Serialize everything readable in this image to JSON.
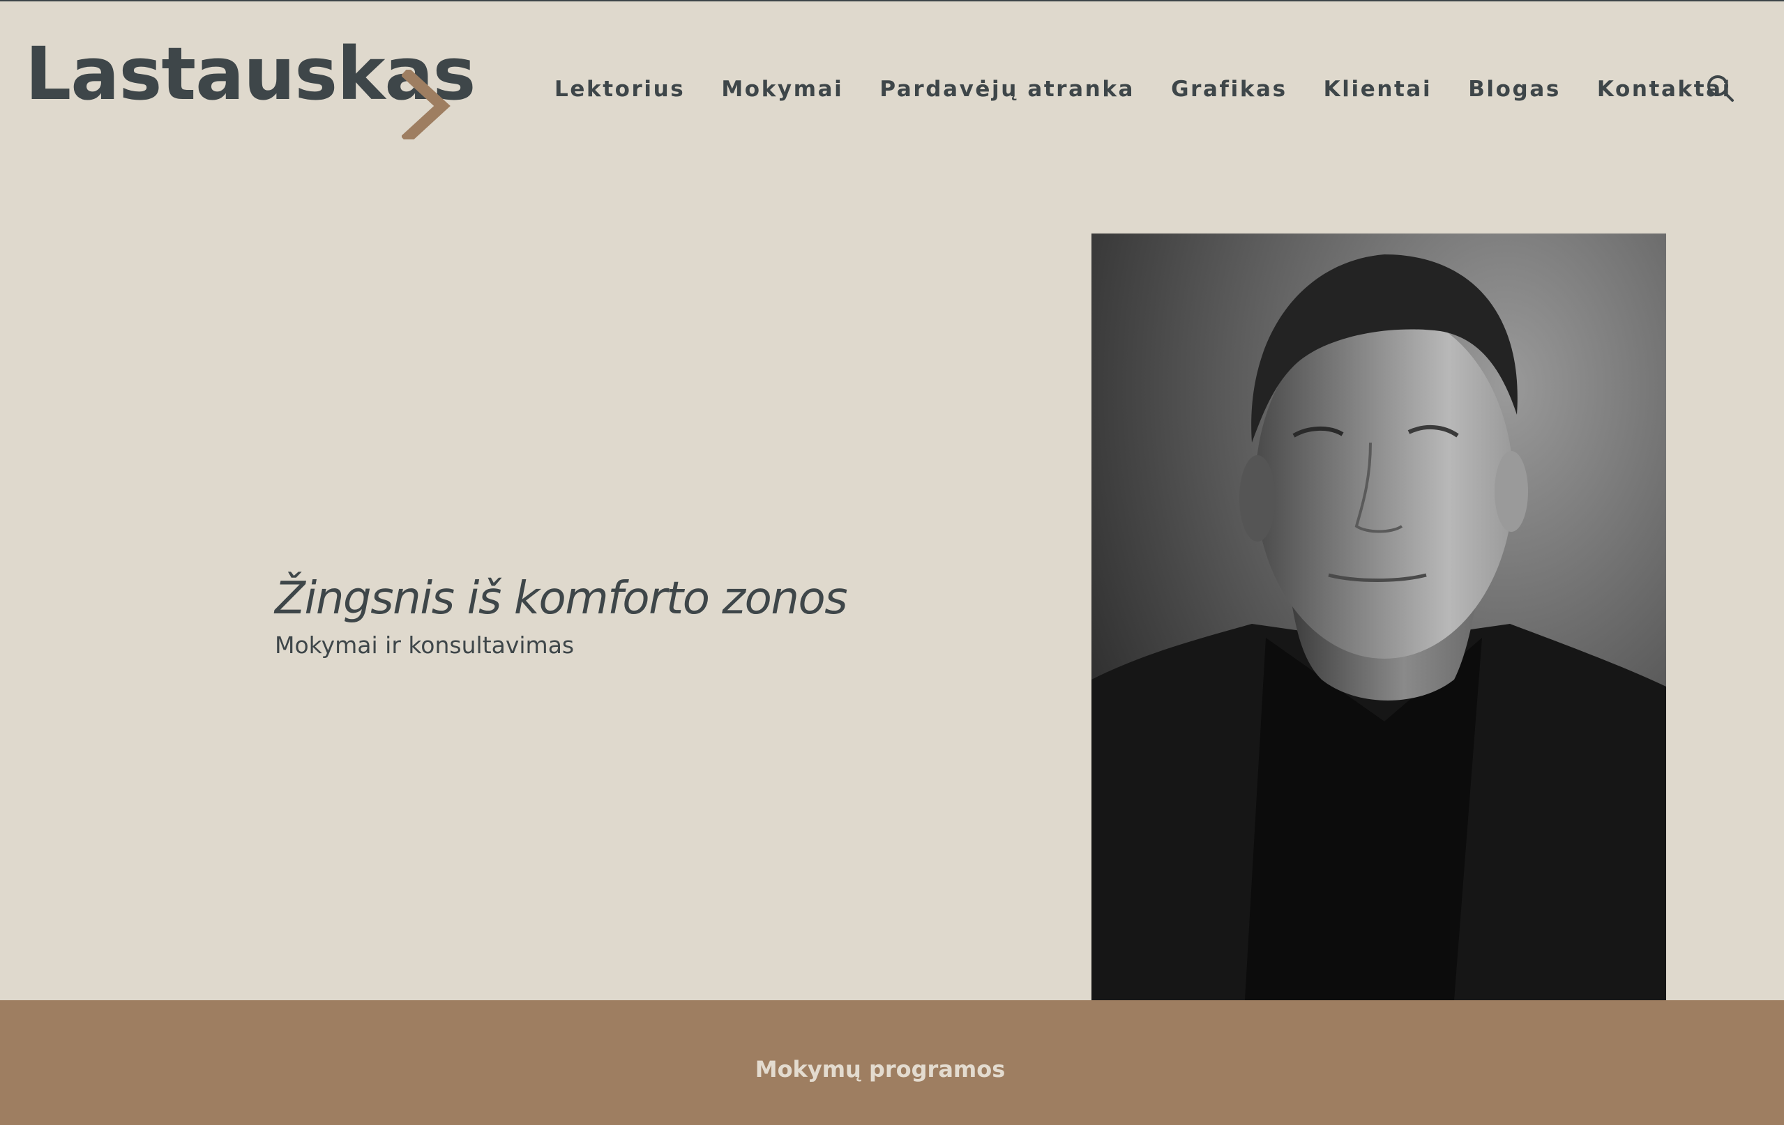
{
  "header": {
    "logo_text": "Lastauskas",
    "nav": [
      {
        "label": "Lektorius"
      },
      {
        "label": "Mokymai"
      },
      {
        "label": "Pardavėjų atranka"
      },
      {
        "label": "Grafikas"
      },
      {
        "label": "Klientai"
      },
      {
        "label": "Blogas"
      },
      {
        "label": "Kontaktai"
      }
    ],
    "search_icon": "search-icon"
  },
  "hero": {
    "title": "Žingsnis iš komforto zonos",
    "subtitle": "Mokymai ir konsultavimas"
  },
  "band": {
    "label": "Mokymų programos"
  },
  "colors": {
    "background": "#dfd9cd",
    "text": "#3e4649",
    "accent": "#9e7e61",
    "band_text": "#e3dbcf"
  }
}
